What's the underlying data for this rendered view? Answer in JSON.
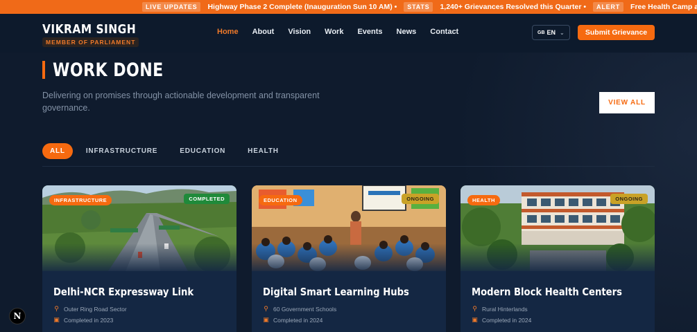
{
  "ticker": {
    "items": [
      {
        "tag": "LIVE UPDATES",
        "text": "Highway Phase 2 Complete (Inauguration Sun 10 AM) •"
      },
      {
        "tag": "STATS",
        "text": "1,240+ Grievances Resolved this Quarter •"
      },
      {
        "tag": "ALERT",
        "text": "Free Health Camp at North Block Hq"
      }
    ]
  },
  "header": {
    "brand_name": "VIKRAM SINGH",
    "brand_badge": "MEMBER OF PARLIAMENT",
    "nav": [
      "Home",
      "About",
      "Vision",
      "Work",
      "Events",
      "News",
      "Contact"
    ],
    "active_nav": "Home",
    "lang_flag": "GB",
    "lang_code": "EN",
    "submit_label": "Submit Grievance"
  },
  "section": {
    "title": "WORK DONE",
    "subtitle": "Delivering on promises through actionable development and transparent governance.",
    "view_all_label": "VIEW ALL",
    "filters": [
      "ALL",
      "INFRASTRUCTURE",
      "EDUCATION",
      "HEALTH"
    ],
    "active_filter": "ALL"
  },
  "cards": [
    {
      "category": "INFRASTRUCTURE",
      "status": "COMPLETED",
      "status_color": "#1f8a3a",
      "title": "Delhi-NCR Expressway Link",
      "location": "Outer Ring Road Sector",
      "date": "Completed in 2023"
    },
    {
      "category": "EDUCATION",
      "status": "ONGOING",
      "status_color": "#c9a227",
      "title": "Digital Smart Learning Hubs",
      "location": "60 Government Schools",
      "date": "Completed in 2024"
    },
    {
      "category": "HEALTH",
      "status": "ONGOING",
      "status_color": "#c9a227",
      "title": "Modern Block Health Centers",
      "location": "Rural Hinterlands",
      "date": "Completed in 2024"
    }
  ],
  "colors": {
    "accent": "#f66a10",
    "background": "#0f1b2d",
    "card": "#142743"
  },
  "dev_badge": "N"
}
